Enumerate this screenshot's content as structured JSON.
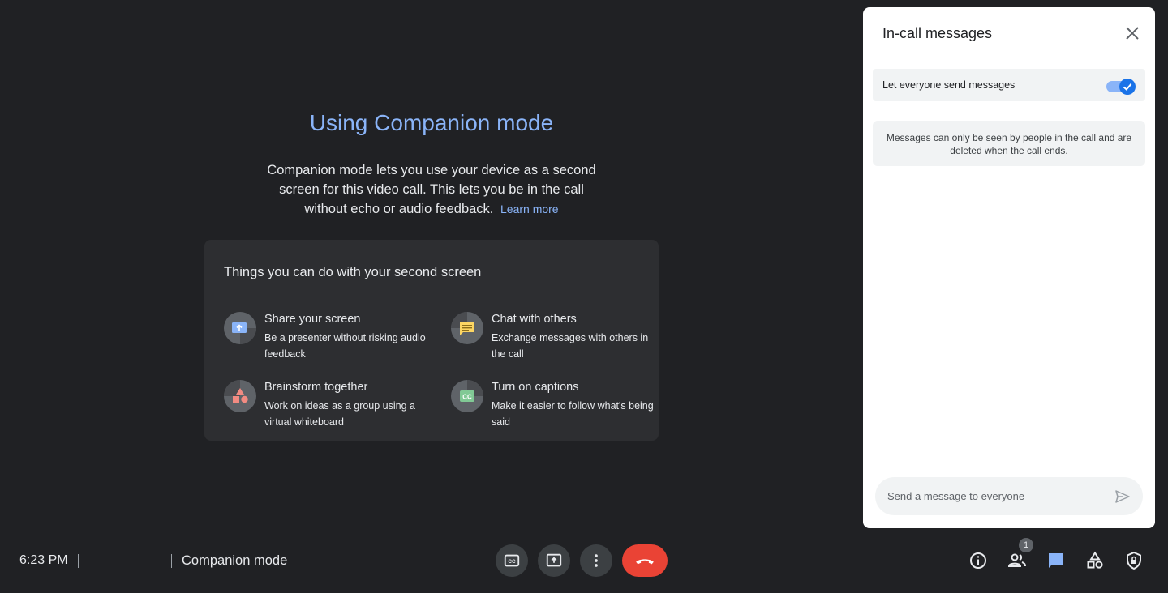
{
  "main": {
    "title": "Using Companion mode",
    "description": "Companion mode lets you use your device as a second screen for this video call. This lets you be in the call without echo or audio feedback.",
    "learn_more": "Learn more",
    "card": {
      "title": "Things you can do with your second screen",
      "features": [
        {
          "title": "Share your screen",
          "desc": "Be a presenter without risking audio feedback",
          "icon": "present-screen-icon"
        },
        {
          "title": "Chat with others",
          "desc": "Exchange messages with others in the call",
          "icon": "chat-icon"
        },
        {
          "title": "Brainstorm together",
          "desc": "Work on ideas as a group using a virtual whiteboard",
          "icon": "whiteboard-shapes-icon"
        },
        {
          "title": "Turn on captions",
          "desc": "Make it easier to follow what's being said",
          "icon": "captions-icon"
        }
      ]
    }
  },
  "panel": {
    "title": "In-call messages",
    "toggle_label": "Let everyone send messages",
    "toggle_on": true,
    "notice": "Messages can only be seen by people in the call and are deleted when the call ends.",
    "input_placeholder": "Send a message to everyone"
  },
  "bottom": {
    "time": "6:23 PM",
    "meeting_name": "Companion mode",
    "participant_count": "1"
  },
  "colors": {
    "accent": "#8ab4f8",
    "hangup": "#ea4335",
    "background": "#202124"
  }
}
